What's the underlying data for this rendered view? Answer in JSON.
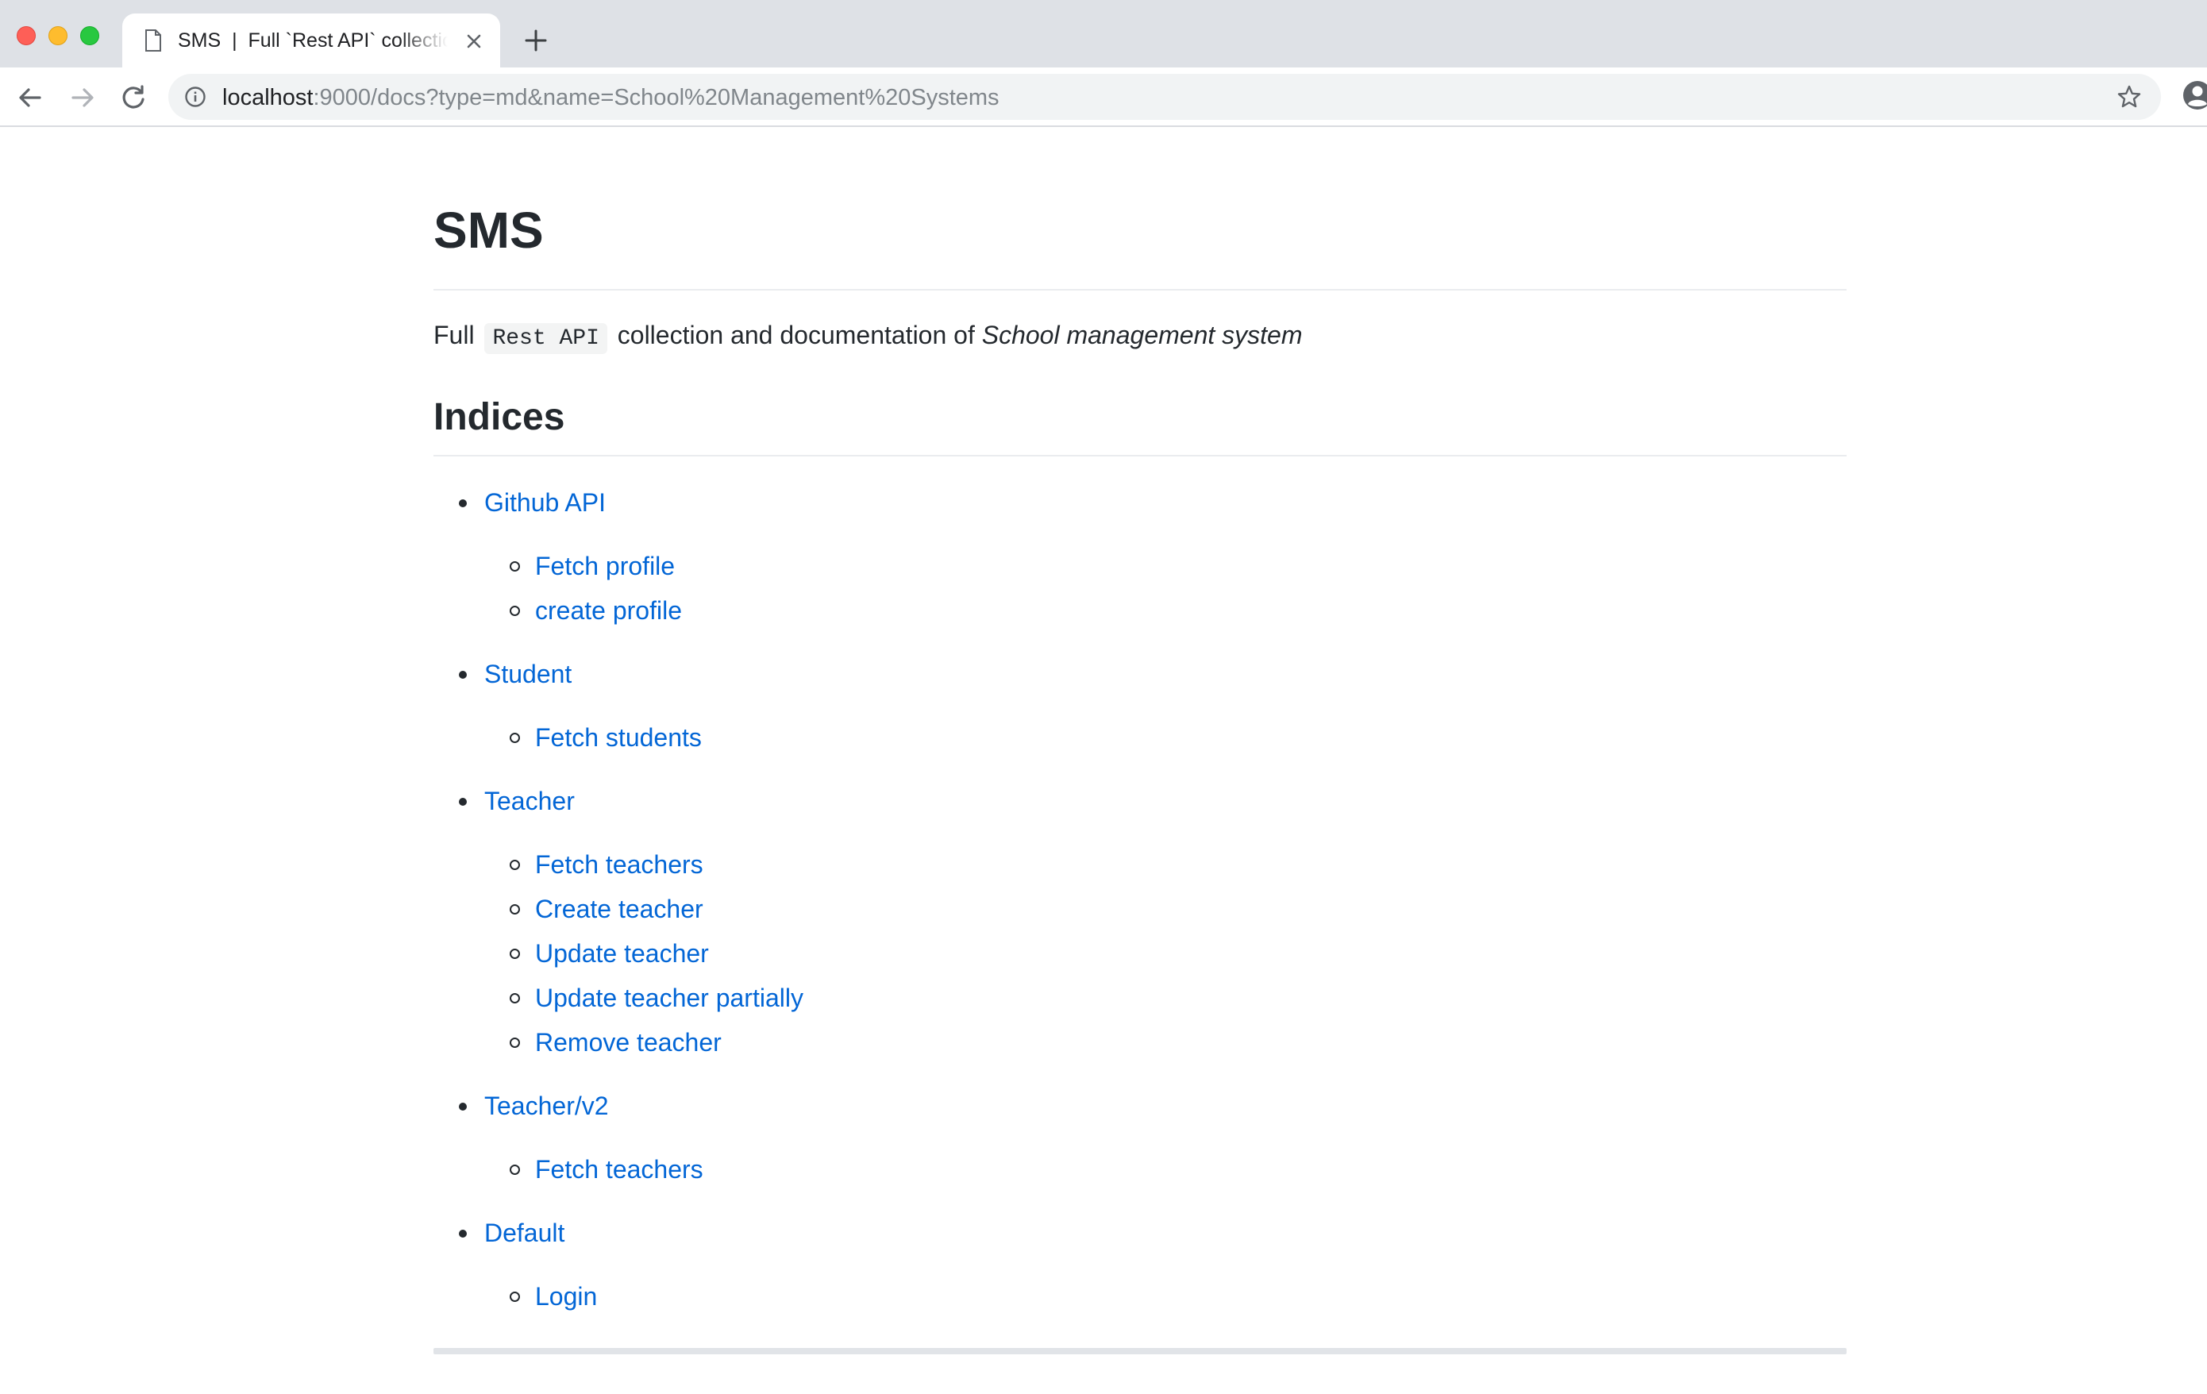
{
  "browser": {
    "tab_title": "SMS  |  Full `Rest API` collection and documentation",
    "url_host": "localhost",
    "url_rest": ":9000/docs?type=md&name=School%20Management%20Systems"
  },
  "page": {
    "title": "SMS",
    "lead_prefix": "Full",
    "lead_code": "Rest API",
    "lead_middle": "collection and documentation of",
    "lead_emphasis": "School management system",
    "indices_heading": "Indices",
    "sections": [
      {
        "label": "Github API",
        "items": [
          "Fetch profile",
          "create profile"
        ]
      },
      {
        "label": "Student",
        "items": [
          "Fetch students"
        ]
      },
      {
        "label": "Teacher",
        "items": [
          "Fetch teachers",
          "Create teacher",
          "Update teacher",
          "Update teacher partially",
          "Remove teacher"
        ]
      },
      {
        "label": "Teacher/v2",
        "items": [
          "Fetch teachers"
        ]
      },
      {
        "label": "Default",
        "items": [
          "Login"
        ]
      }
    ]
  }
}
